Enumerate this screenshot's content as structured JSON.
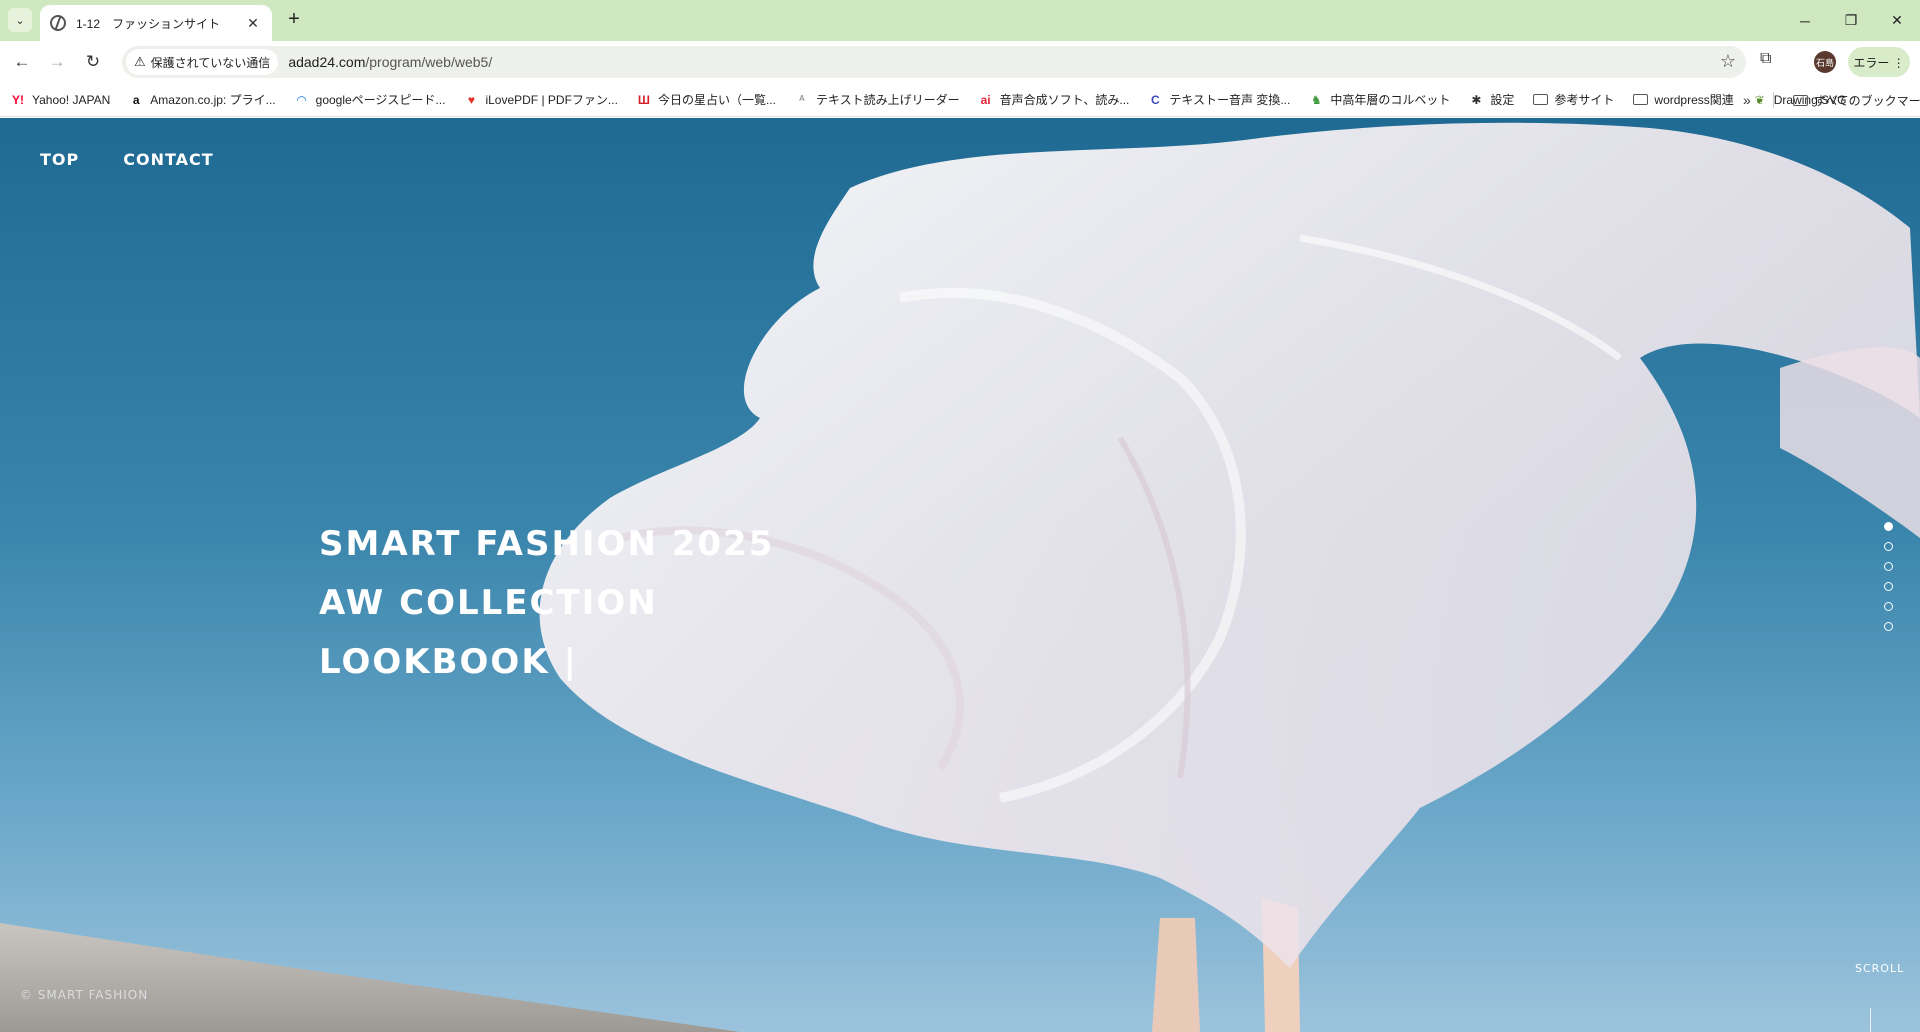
{
  "browser": {
    "tab": {
      "title": "1-12　ファッションサイト"
    },
    "window_controls": [
      "─",
      "❐",
      "✕"
    ],
    "address": {
      "security_label": "保護されていない通信",
      "domain": "adad24.com",
      "path": "/program/web/web5/"
    },
    "profile_initials": "石島",
    "error_label": "エラー ⋮",
    "bookmarks": [
      {
        "label": "Yahoo! JAPAN",
        "icon": "yahoo-icon",
        "glyph": "Y!",
        "color": "#ff0033"
      },
      {
        "label": "Amazon.co.jp: プライ...",
        "icon": "amazon-icon",
        "glyph": "a",
        "color": "#111111"
      },
      {
        "label": "googleページスピード...",
        "icon": "pagespeed-icon",
        "glyph": "◠",
        "color": "#1a73e8"
      },
      {
        "label": "iLovePDF | PDFファン...",
        "icon": "heart-icon",
        "glyph": "♥",
        "color": "#e5322d"
      },
      {
        "label": "今日の星占い（一覧...",
        "icon": "calendar-icon",
        "glyph": "Ш",
        "color": "#d0202a"
      },
      {
        "label": "テキスト読み上げリーダー",
        "icon": "reader-icon",
        "glyph": "ᴬ",
        "color": "#999999"
      },
      {
        "label": "音声合成ソフト、読み...",
        "icon": "ai-icon",
        "glyph": "ai",
        "color": "#e0243c"
      },
      {
        "label": "テキストー音声 変換...",
        "icon": "c-icon",
        "glyph": "C",
        "color": "#3b4cb8"
      },
      {
        "label": "中高年層のコルベット",
        "icon": "android-icon",
        "glyph": "♞",
        "color": "#3c9a3c"
      },
      {
        "label": "設定",
        "icon": "gear-icon",
        "glyph": "✱",
        "color": "#333333"
      },
      {
        "label": "参考サイト",
        "icon": "folder-icon",
        "glyph": "",
        "color": "#555555"
      },
      {
        "label": "wordpress関連",
        "icon": "folder-icon",
        "glyph": "",
        "color": "#555555"
      },
      {
        "label": "Drawing SVG",
        "icon": "leaf-icon",
        "glyph": "❦",
        "color": "#5a8a2a"
      }
    ],
    "all_bookmarks_label": "すべてのブックマーク"
  },
  "site": {
    "nav": [
      "TOP",
      "CONTACT"
    ],
    "hero_lines": [
      "SMART FASHION 2025",
      "AW COLLECTION",
      "LOOKBOOK |"
    ],
    "slide_count": 6,
    "active_slide": 1,
    "scroll_label": "SCROLL",
    "footer_logo": "© SMART FASHION"
  },
  "colors": {
    "tabbar": "#cfe8c0",
    "sky_top": "#1f6a93",
    "sky_bottom": "#9cc3dc",
    "cloth": "#f3ecef"
  }
}
